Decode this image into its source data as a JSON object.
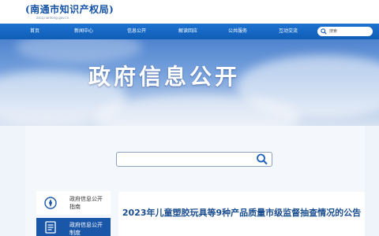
{
  "header": {
    "logo_title": "(南通市知识产权局)",
    "logo_subtitle": "zscq.nantong.gov.cn"
  },
  "nav": {
    "items": [
      {
        "label": "首页"
      },
      {
        "label": "新闻中心"
      },
      {
        "label": "信息公开"
      },
      {
        "label": "解读回应"
      },
      {
        "label": "公共服务"
      },
      {
        "label": "互动交流"
      }
    ],
    "search_placeholder": "搜索"
  },
  "hero": {
    "title": "政府信息公开"
  },
  "search": {
    "value": ""
  },
  "sidebar": {
    "items": [
      {
        "label": "政府信息公开指南",
        "icon": "compass-icon",
        "active": false
      },
      {
        "label": "政府信息公开制度",
        "icon": "document-list-icon",
        "active": true
      }
    ]
  },
  "article": {
    "title": "2023年儿童塑胶玩具等9种产品质量市级监督抽查情况的公告"
  },
  "colors": {
    "nav_blue": "#1565c4",
    "brand_blue": "#1452a6",
    "active_sidebar": "#1a57a8"
  }
}
